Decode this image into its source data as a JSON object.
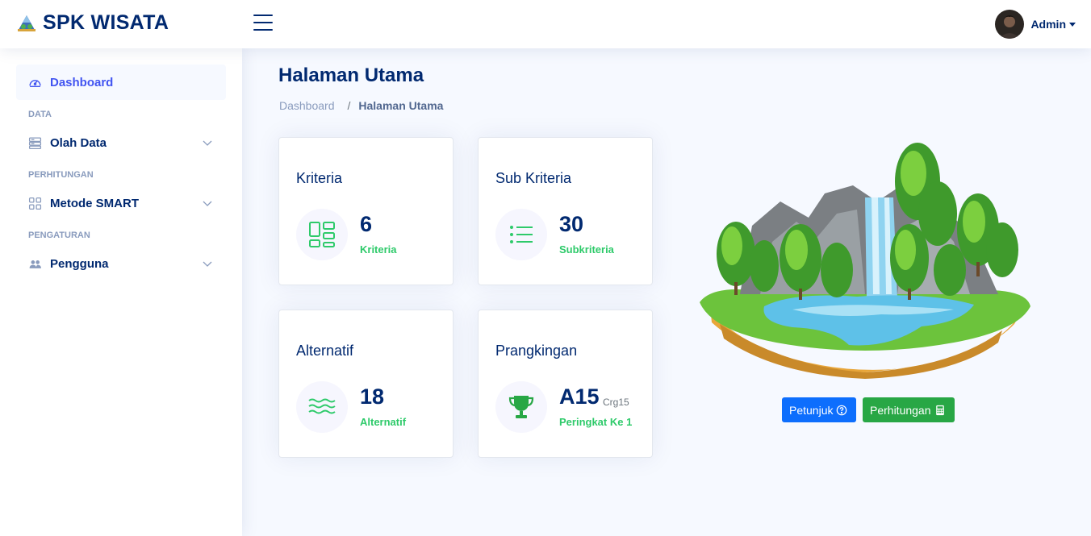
{
  "header": {
    "app_title": "SPK WISATA",
    "user_name": "Admin"
  },
  "sidebar": {
    "items": [
      {
        "label": "Dashboard",
        "icon": "speedometer-icon",
        "active": true
      },
      {
        "heading": "DATA"
      },
      {
        "label": "Olah Data",
        "icon": "server-icon"
      },
      {
        "heading": "PERHITUNGAN"
      },
      {
        "label": "Metode SMART",
        "icon": "grid-icon"
      },
      {
        "heading": "PENGATURAN"
      },
      {
        "label": "Pengguna",
        "icon": "people-icon"
      }
    ]
  },
  "main": {
    "title": "Halaman Utama",
    "breadcrumb": {
      "home": "Dashboard",
      "current": "Halaman Utama"
    },
    "cards": [
      {
        "title": "Kriteria",
        "value": "6",
        "sub": "Kriteria",
        "icon": "layout-grid-icon"
      },
      {
        "title": "Sub Kriteria",
        "value": "30",
        "sub": "Subkriteria",
        "icon": "list-icon"
      },
      {
        "title": "Alternatif",
        "value": "18",
        "sub": "Alternatif",
        "icon": "water-waves-icon"
      },
      {
        "title": "Prangkingan",
        "value": "A15",
        "small": "Crg15",
        "sub": "Peringkat Ke 1",
        "icon": "trophy-icon"
      }
    ],
    "buttons": {
      "petunjuk": "Petunjuk",
      "perhitungan": "Perhitungan"
    }
  },
  "colors": {
    "primary": "#012970",
    "accent": "#4154f1",
    "success": "#2eca6a",
    "button_blue": "#0d6efd",
    "button_green": "#28a745"
  }
}
